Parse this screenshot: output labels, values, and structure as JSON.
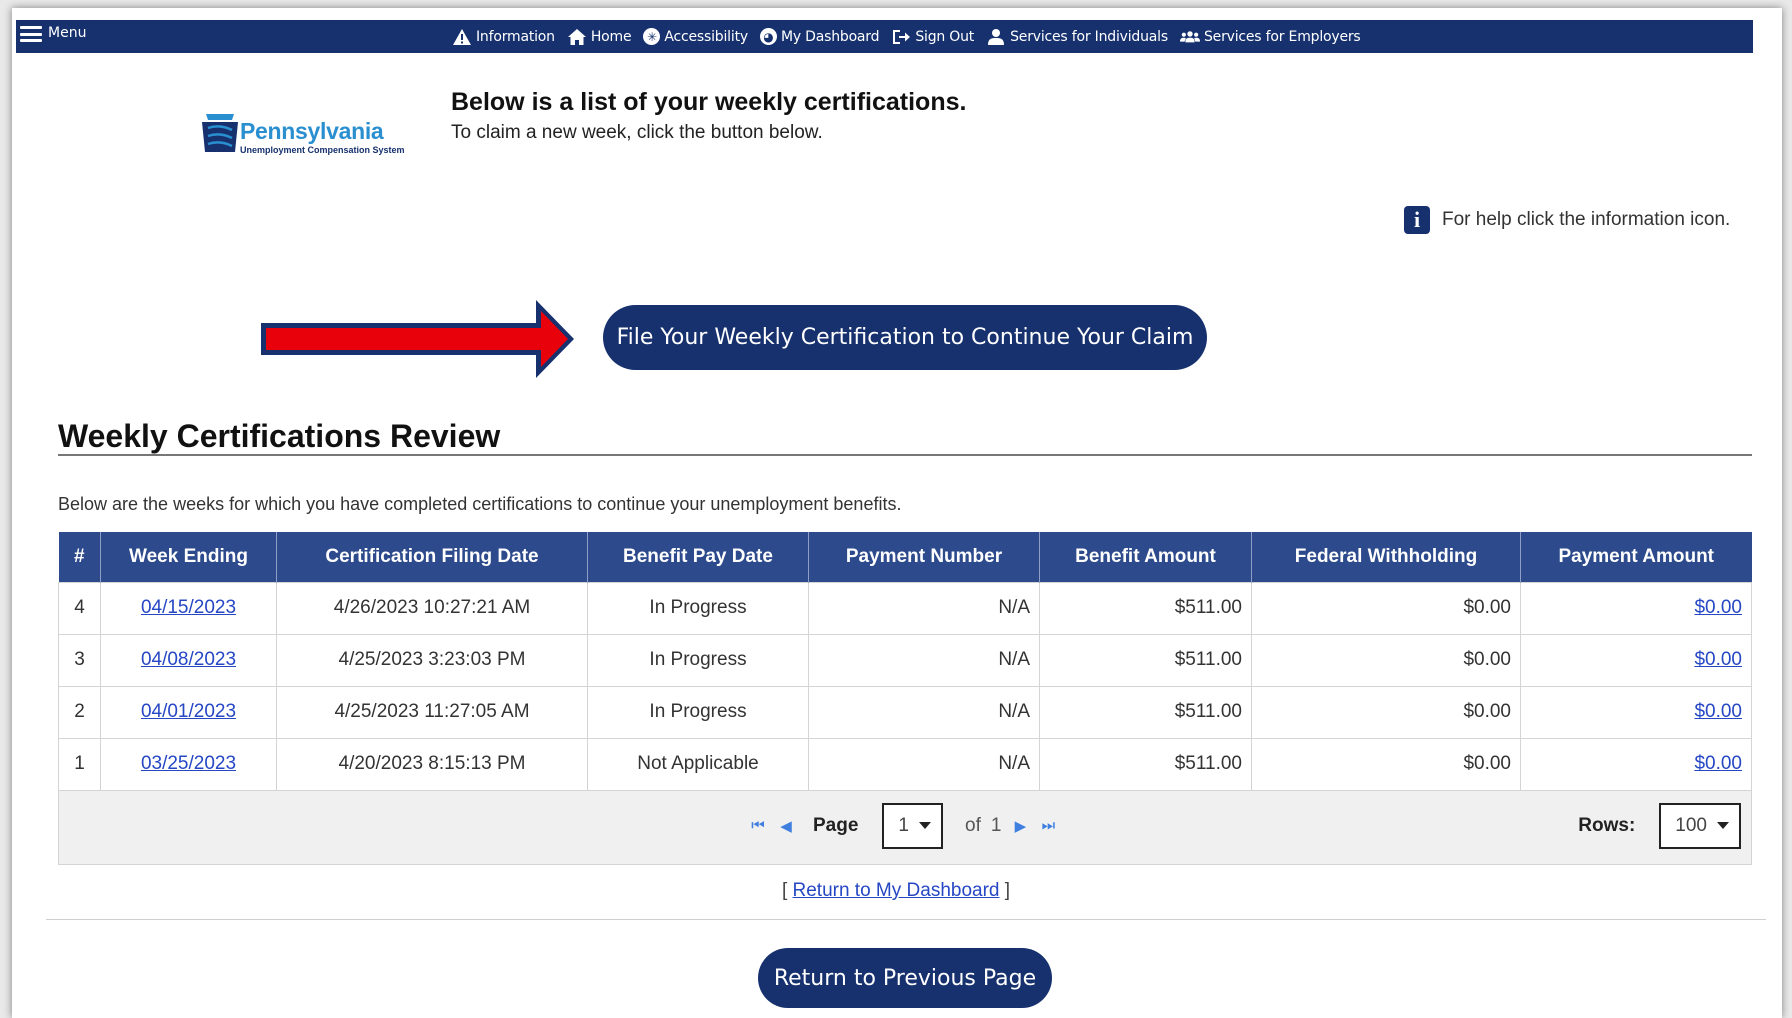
{
  "nav": {
    "menu_label": "Menu",
    "links": [
      {
        "label": "Information",
        "icon": "warning-icon"
      },
      {
        "label": "Home",
        "icon": "home-icon"
      },
      {
        "label": "Accessibility",
        "icon": "accessibility-icon"
      },
      {
        "label": "My Dashboard",
        "icon": "dashboard-icon"
      },
      {
        "label": "Sign Out",
        "icon": "sign-out-icon"
      },
      {
        "label": "Services for Individuals",
        "icon": "user-icon"
      },
      {
        "label": "Services for Employers",
        "icon": "users-icon"
      }
    ]
  },
  "logo": {
    "name": "Pennsylvania",
    "subtitle": "Unemployment Compensation System"
  },
  "intro": {
    "title": "Below is a list of your weekly certifications.",
    "subtitle": "To claim a new week, click the button below."
  },
  "help_text": "For help click the information icon.",
  "file_button": "File Your Weekly Certification to Continue Your Claim",
  "review": {
    "title": "Weekly Certifications Review",
    "description": "Below are the weeks for which you have completed certifications to continue your unemployment benefits."
  },
  "table": {
    "columns": [
      "#",
      "Week Ending",
      "Certification Filing Date",
      "Benefit Pay Date",
      "Payment Number",
      "Benefit Amount",
      "Federal Withholding",
      "Payment Amount"
    ],
    "rows": [
      {
        "num": "4",
        "week": "04/15/2023",
        "filed": "4/26/2023 10:27:21 AM",
        "pay_date": "In Progress",
        "pay_num": "N/A",
        "benefit": "$511.00",
        "federal": "$0.00",
        "amount": "$0.00"
      },
      {
        "num": "3",
        "week": "04/08/2023",
        "filed": "4/25/2023 3:23:03 PM",
        "pay_date": "In Progress",
        "pay_num": "N/A",
        "benefit": "$511.00",
        "federal": "$0.00",
        "amount": "$0.00"
      },
      {
        "num": "2",
        "week": "04/01/2023",
        "filed": "4/25/2023 11:27:05 AM",
        "pay_date": "In Progress",
        "pay_num": "N/A",
        "benefit": "$511.00",
        "federal": "$0.00",
        "amount": "$0.00"
      },
      {
        "num": "1",
        "week": "03/25/2023",
        "filed": "4/20/2023 8:15:13 PM",
        "pay_date": "Not Applicable",
        "pay_num": "N/A",
        "benefit": "$511.00",
        "federal": "$0.00",
        "amount": "$0.00"
      }
    ]
  },
  "pager": {
    "page_label": "Page",
    "current_page": "1",
    "of_label": "of",
    "total_pages": "1",
    "rows_label": "Rows:",
    "rows_value": "100"
  },
  "return_dashboard": {
    "open": "[",
    "label": "Return to My Dashboard",
    "close": "]"
  },
  "prev_button": "Return to Previous Page",
  "colors": {
    "navy": "#16316e",
    "header_blue": "#2d4a8c",
    "link": "#2647c4",
    "arrow_red": "#e8000b"
  }
}
